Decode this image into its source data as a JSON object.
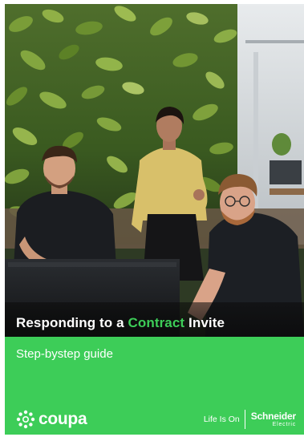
{
  "cover": {
    "title_prefix": "Responding to a ",
    "title_highlight": "Contract",
    "title_suffix": " Invite",
    "subtitle": "Step-bystep guide",
    "photo_description_icon": "office-team-photo"
  },
  "logos": {
    "coupa": {
      "text": "coupa",
      "icon": "coupa-burst-icon"
    },
    "schneider": {
      "tagline_pre": "Life Is ",
      "tagline_on": "On",
      "name": "Schneider",
      "name_sub": "Electric"
    }
  },
  "colors": {
    "brand_green": "#3dcd58",
    "text_white": "#ffffff",
    "title_band": "#111111"
  }
}
